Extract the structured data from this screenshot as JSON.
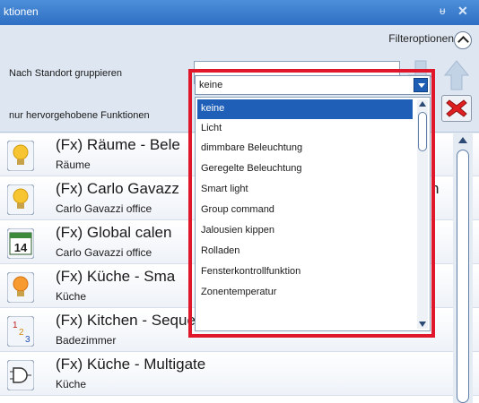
{
  "titlebar": {
    "title": "ktionen",
    "pin_glyph": "ᵾ",
    "close_glyph": "✕"
  },
  "filter": {
    "options_label": "Filteroptionen",
    "group_by_location_label": "Nach Standort gruppieren",
    "group_by_location_value": "",
    "highlighted_label": "nur hervorgehobene Funktionen",
    "highlighted_value": "keine"
  },
  "dropdown": {
    "items": [
      "keine",
      "Licht",
      "dimmbare Beleuchtung",
      "Geregelte Beleuchtung",
      "Smart light",
      "Group command",
      "Jalousien kippen",
      "Rolladen",
      "Fensterkontrollfunktion",
      "Zonentemperatur"
    ],
    "selected_index": 0
  },
  "list": {
    "rows": [
      {
        "name": "(Fx) Räume - Bele",
        "place": "Räume",
        "icon": "lightbulb-icon",
        "tail": ""
      },
      {
        "name": "(Fx) Carlo Gavazz",
        "place": "Carlo Gavazzi office",
        "icon": "lightbulb-icon",
        "tail": "n"
      },
      {
        "name": "(Fx) Global calen",
        "place": "Carlo Gavazzi office",
        "icon": "calendar-icon",
        "icon_text": "14",
        "tail": ""
      },
      {
        "name": "(Fx) Küche - Sma",
        "place": "Küche",
        "icon": "lightbulb-icon",
        "tail": ""
      },
      {
        "name": "(Fx) Kitchen - Sequence",
        "place": "Badezimmer",
        "icon": "sequence-icon",
        "tail": ""
      },
      {
        "name": "(Fx) Küche - Multigate",
        "place": "Küche",
        "icon": "logic-gate-icon",
        "tail": ""
      }
    ]
  },
  "colors": {
    "accent": "#2f6fc4",
    "highlight_frame": "#e0162b",
    "selected_item": "#1f5fb8"
  }
}
